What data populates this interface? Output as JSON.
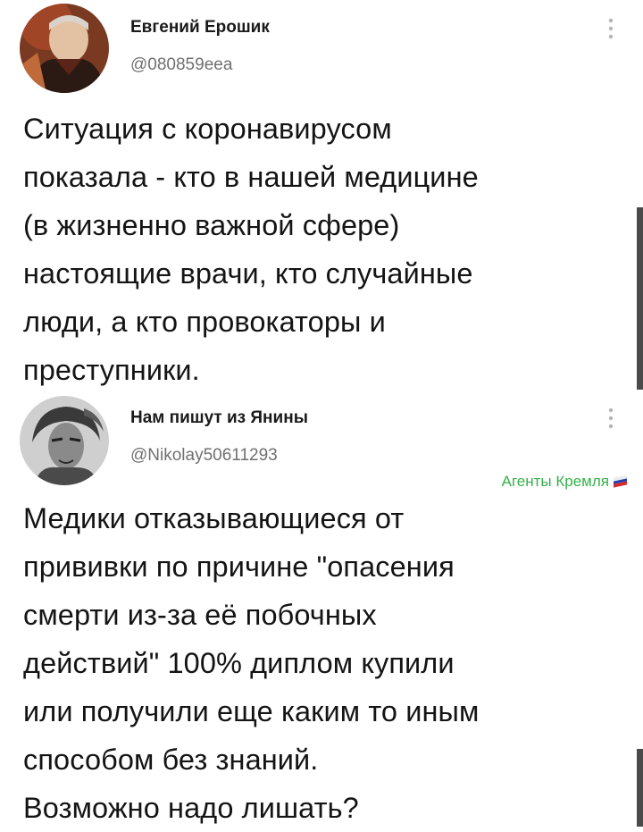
{
  "tweets": [
    {
      "author_name": "Евгений Ерошик",
      "author_handle": "@080859eea",
      "text": "Ситуация с коронавирусом\nпоказала - кто в нашей медицине\n(в жизненно важной сфере)\nнастоящие врачи, кто случайные\nлюди, а кто провокаторы и\nпреступники.",
      "avatar_icon": "user-avatar-photo",
      "more_icon": "more-vertical-icon"
    },
    {
      "author_name": "Нам пишут из Янины",
      "author_handle": "@Nikolay50611293",
      "text": "Медики отказывающиеся от\nпрививки по причине \"опасения\nсмерти из-за её побочных\nдействий\" 100% диплом купили\nили получили еще каким то иным\nспособом без знаний.\nВозможно надо лишать?",
      "avatar_icon": "user-avatar-photo",
      "more_icon": "more-vertical-icon"
    }
  ],
  "watermark": {
    "text": "Агенты Кремля",
    "color": "#36b04a",
    "icon": "russian-flag-icon"
  },
  "colors": {
    "text": "#141414",
    "handle": "#707070",
    "scroll_indicator": "#4a4a4a"
  }
}
